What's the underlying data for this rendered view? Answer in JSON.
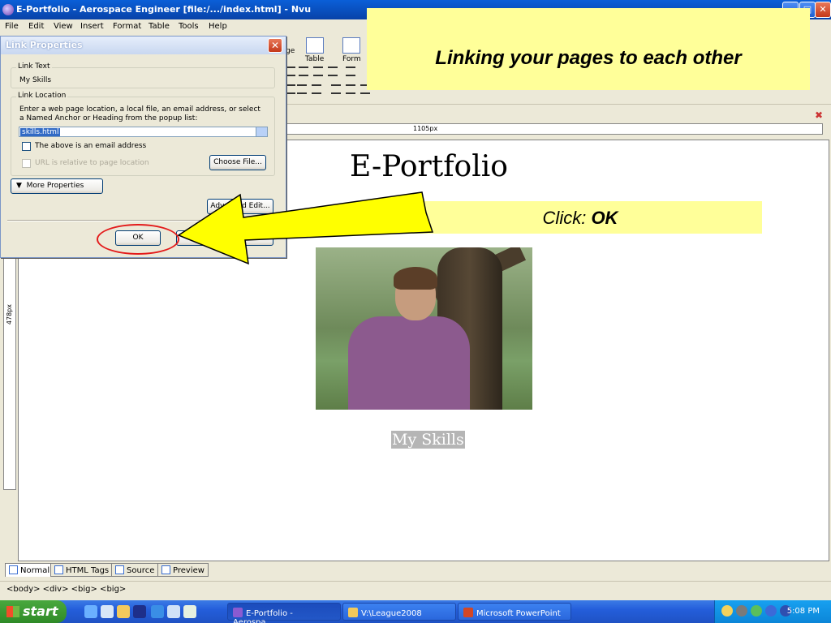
{
  "window": {
    "title": "E-Portfolio - Aerospace Engineer [file:/.../index.html] - Nvu"
  },
  "menu": [
    "File",
    "Edit",
    "View",
    "Insert",
    "Format",
    "Table",
    "Tools",
    "Help"
  ],
  "toolbar": {
    "table_label": "Table",
    "form_label": "Form",
    "cut_label": "ge"
  },
  "callouts": {
    "top": "Linking your pages to each other",
    "click_prefix": "Click: ",
    "click_bold": "OK"
  },
  "ruler": {
    "width_label": "1105px",
    "height_label": "478px"
  },
  "document": {
    "heading": "E-Portfolio",
    "link_text": "My Skills"
  },
  "dialog": {
    "title": "Link Properties",
    "link_text_legend": "Link Text",
    "link_text_value": "My Skills",
    "location_legend": "Link Location",
    "location_hint": "Enter a web page location, a local file, an email address, or select a Named Anchor or Heading from the popup list:",
    "url_value": "skills.html",
    "email_checkbox": "The above is an email address",
    "relative_checkbox": "URL is relative to page location",
    "choose_file": "Choose File...",
    "more_properties": "More Properties",
    "advanced_edit": "Advanced Edit...",
    "ok": "OK"
  },
  "mode_tabs": [
    "Normal",
    "HTML Tags",
    "Source",
    "Preview"
  ],
  "status_bar": "<body> <div> <big> <big>",
  "taskbar": {
    "start": "start",
    "tasks": [
      "E-Portfolio - Aerospa...",
      "V:\\League2008",
      "Microsoft PowerPoint ..."
    ],
    "clock": "5:08 PM"
  },
  "colors": {
    "callout": "#ffff99",
    "highlight_ring": "#e31b1b",
    "arrow": "#ffff00"
  }
}
